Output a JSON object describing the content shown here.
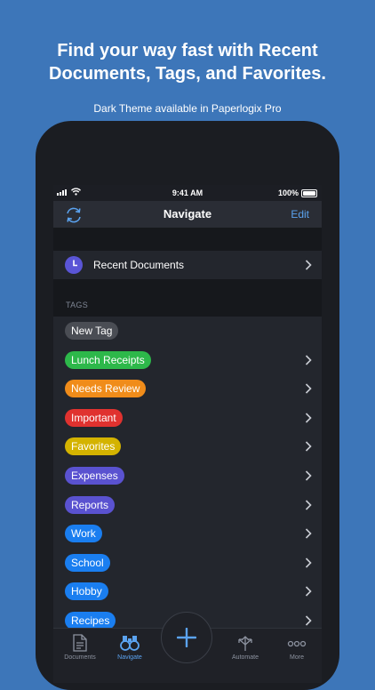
{
  "promo": {
    "headline_line1": "Find your way fast with Recent",
    "headline_line2": "Documents, Tags, and Favorites.",
    "subtitle": "Dark Theme available in Paperlogix Pro"
  },
  "status_bar": {
    "time": "9:41 AM",
    "battery": "100%"
  },
  "nav_bar": {
    "title": "Navigate",
    "edit_label": "Edit",
    "left_icon": "sync-icon"
  },
  "recent": {
    "label": "Recent Documents",
    "icon": "clock-icon",
    "icon_color": "#5a55d6"
  },
  "tags": {
    "header": "TAGS",
    "items": [
      {
        "label": "New Tag",
        "color": "#4a4d54",
        "chevron": false
      },
      {
        "label": "Lunch Receipts",
        "color": "#2db84a",
        "chevron": true
      },
      {
        "label": "Needs Review",
        "color": "#f08c1a",
        "chevron": true
      },
      {
        "label": "Important",
        "color": "#e0322f",
        "chevron": true
      },
      {
        "label": "Favorites",
        "color": "#d4b300",
        "chevron": true
      },
      {
        "label": "Expenses",
        "color": "#5a52d0",
        "chevron": true
      },
      {
        "label": "Reports",
        "color": "#5a52d0",
        "chevron": true
      },
      {
        "label": "Work",
        "color": "#1a7ef0",
        "chevron": true
      },
      {
        "label": "School",
        "color": "#1a7ef0",
        "chevron": true
      },
      {
        "label": "Hobby",
        "color": "#1a7ef0",
        "chevron": true
      },
      {
        "label": "Recipes",
        "color": "#1a7ef0",
        "chevron": true
      }
    ]
  },
  "tab_bar": {
    "documents": "Documents",
    "navigate": "Navigate",
    "automate": "Automate",
    "more": "More",
    "active_color": "#5ba3f0"
  },
  "colors": {
    "background": "#3d76b9",
    "accent": "#5ba3f0"
  }
}
